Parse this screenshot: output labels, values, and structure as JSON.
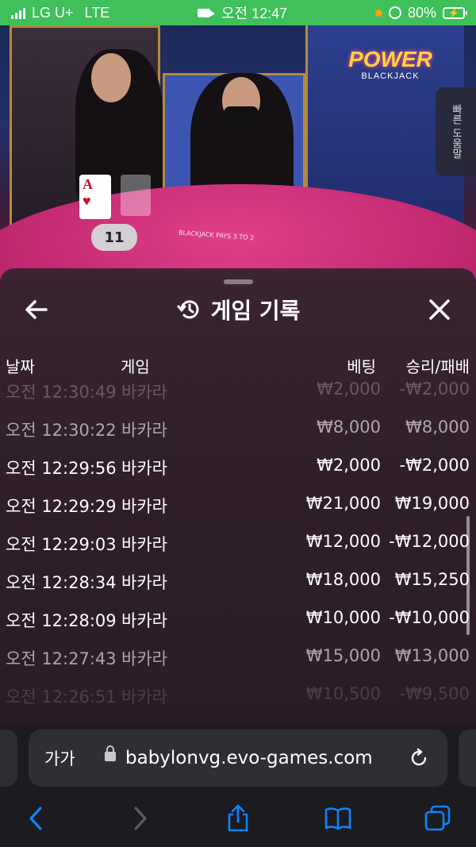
{
  "status_bar": {
    "carrier": "LG U+",
    "network": "LTE",
    "time": "오전 12:47",
    "battery": "80%"
  },
  "scene": {
    "logo_main": "POWER",
    "logo_sub": "BLACKJACK",
    "card_label": "A",
    "hand_score": "11",
    "quick_label": "빠른 도움말",
    "pay_text": "BLACKJACK PAYS 3 TO 2"
  },
  "history": {
    "title": "게임 기록",
    "columns": {
      "date": "날짜",
      "game": "게임",
      "bet": "베팅",
      "result": "승리/패배"
    },
    "rows": [
      {
        "time": "오전 12:30:49",
        "game": "바카라",
        "bet": "₩2,000",
        "result": "-₩2,000"
      },
      {
        "time": "오전 12:30:22",
        "game": "바카라",
        "bet": "₩8,000",
        "result": "₩8,000"
      },
      {
        "time": "오전 12:29:56",
        "game": "바카라",
        "bet": "₩2,000",
        "result": "-₩2,000"
      },
      {
        "time": "오전 12:29:29",
        "game": "바카라",
        "bet": "₩21,000",
        "result": "₩19,000"
      },
      {
        "time": "오전 12:29:03",
        "game": "바카라",
        "bet": "₩12,000",
        "result": "-₩12,000"
      },
      {
        "time": "오전 12:28:34",
        "game": "바카라",
        "bet": "₩18,000",
        "result": "₩15,250"
      },
      {
        "time": "오전 12:28:09",
        "game": "바카라",
        "bet": "₩10,000",
        "result": "-₩10,000"
      },
      {
        "time": "오전 12:27:43",
        "game": "바카라",
        "bet": "₩15,000",
        "result": "₩13,000"
      },
      {
        "time": "오전 12:26:51",
        "game": "바카라",
        "bet": "₩10,500",
        "result": "-₩9,500"
      }
    ]
  },
  "browser": {
    "text_size_label": "가가",
    "domain": "babylonvg.evo-games.com"
  },
  "colors": {
    "status_green": "#3fc05a",
    "sheet_bg": "#32202c",
    "link_blue": "#0a84ff"
  }
}
